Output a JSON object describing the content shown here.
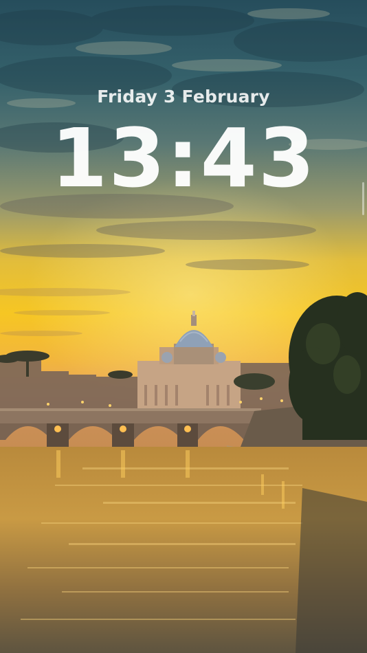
{
  "lockscreen": {
    "date": "Friday 3 February",
    "time": "13:43"
  },
  "wallpaper": {
    "icon": "sunset-rome-photo",
    "colors": {
      "sky_top": "#2e5866",
      "sky_mid": "#7d8b74",
      "sunset": "#f5c12c",
      "horizon": "#f4a63c",
      "water": "#b88b3a",
      "trees": "#2a3320"
    }
  }
}
